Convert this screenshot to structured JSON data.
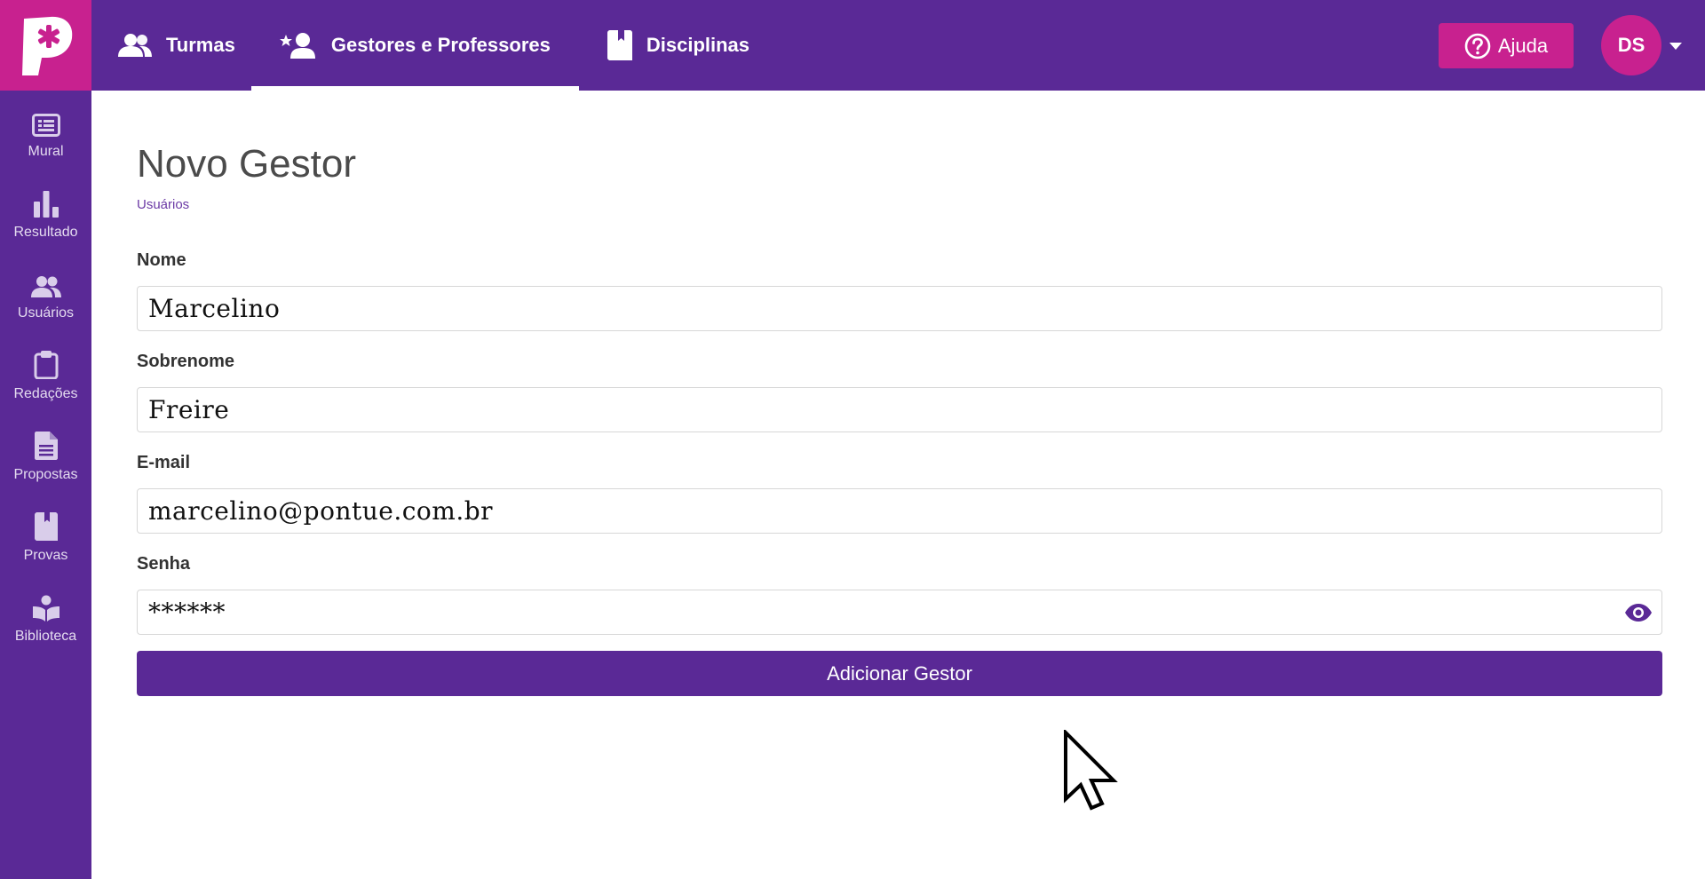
{
  "colors": {
    "primary": "#5a2996",
    "accent": "#c8218f"
  },
  "nav": {
    "items": [
      {
        "label": "Turmas",
        "icon": "users-icon"
      },
      {
        "label": "Gestores e Professores",
        "icon": "user-star-icon"
      },
      {
        "label": "Disciplinas",
        "icon": "book-icon"
      }
    ]
  },
  "header": {
    "help_label": "Ajuda",
    "avatar_initials": "DS"
  },
  "sidebar": {
    "items": [
      {
        "label": "Mural",
        "icon": "board-icon"
      },
      {
        "label": "Resultado",
        "icon": "bar-chart-icon"
      },
      {
        "label": "Usuários",
        "icon": "users-icon"
      },
      {
        "label": "Redações",
        "icon": "clipboard-icon"
      },
      {
        "label": "Propostas",
        "icon": "file-text-icon"
      },
      {
        "label": "Provas",
        "icon": "book-icon"
      },
      {
        "label": "Biblioteca",
        "icon": "reader-icon"
      }
    ]
  },
  "page": {
    "title": "Novo Gestor",
    "breadcrumb": "Usuários"
  },
  "form": {
    "nome_label": "Nome",
    "nome_value": "Marcelino",
    "sobrenome_label": "Sobrenome",
    "sobrenome_value": "Freire",
    "email_label": "E-mail",
    "email_value": "marcelino@pontue.com.br",
    "senha_label": "Senha",
    "senha_value": "******",
    "submit_label": "Adicionar Gestor"
  }
}
